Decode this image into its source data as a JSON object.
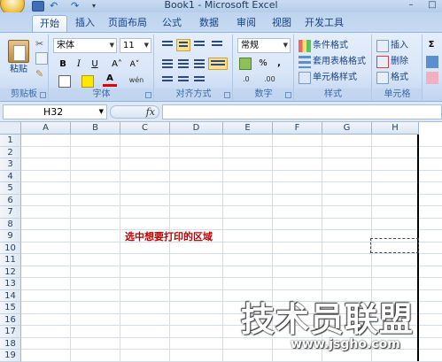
{
  "window": {
    "title": "Book1 - Microsoft Excel",
    "minimize_glyph": "–",
    "maximize_glyph": "□"
  },
  "quick_access": {
    "undo_glyph": "↶ ▾",
    "redo_glyph": "↷ ▾",
    "more_glyph": "▾"
  },
  "tabs": [
    "开始",
    "插入",
    "页面布局",
    "公式",
    "数据",
    "审阅",
    "视图",
    "开发工具"
  ],
  "ribbon": {
    "clipboard": {
      "label": "剪贴板",
      "paste": "粘贴"
    },
    "font": {
      "label": "字体",
      "font_name": "宋体",
      "font_size": "11",
      "bold": "B",
      "italic": "I",
      "underline": "U",
      "grow": "A˄",
      "shrink": "A˅",
      "fill_glyph": "A",
      "wen": "wén"
    },
    "alignment": {
      "label": "对齐方式"
    },
    "number": {
      "label": "数字",
      "format": "常规",
      "percent": "%",
      "comma": ","
    },
    "styles": {
      "label": "样式",
      "conditional": "条件格式",
      "table_format": "套用表格格式",
      "cell_styles": "单元格样式"
    },
    "cells": {
      "label": "单元格",
      "insert": "插入",
      "delete": "删除",
      "format": "格式"
    },
    "editing": {
      "sigma": "Σ"
    }
  },
  "formula_bar": {
    "name_box": "H32",
    "fx": "fx"
  },
  "grid": {
    "columns": [
      "A",
      "B",
      "C",
      "D",
      "E",
      "F",
      "G",
      "H"
    ],
    "rows": [
      "1",
      "2",
      "3",
      "4",
      "5",
      "6",
      "7",
      "8",
      "9",
      "10",
      "11",
      "12",
      "13",
      "14",
      "15",
      "16",
      "17",
      "18",
      "19"
    ],
    "annotation": "选中想要打印的区域"
  },
  "watermark": {
    "main": "技术员联盟",
    "url": "www.jsgho.com"
  },
  "colors": {
    "annotation": "#c00000",
    "ribbon_bg": "#d9e6f7"
  }
}
